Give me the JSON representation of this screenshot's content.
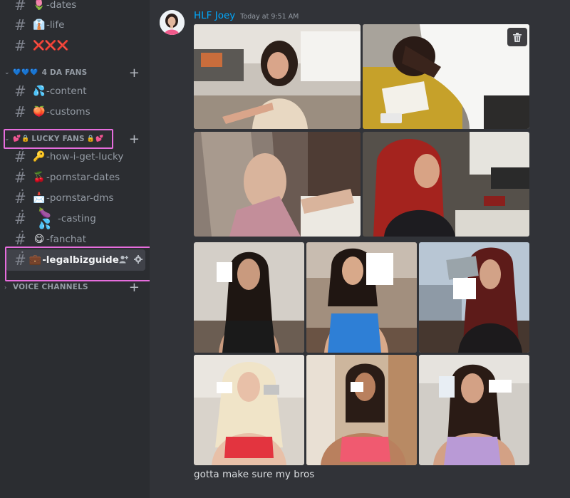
{
  "sidebar": {
    "channels_top": [
      {
        "emoji": "🌷",
        "label": "-dates"
      },
      {
        "emoji": "👔",
        "label": "-life"
      },
      {
        "emoji": "",
        "label": "❌❌❌"
      }
    ],
    "category_fans": {
      "emoji": "💙💙💙",
      "label": "4 DA FANS"
    },
    "channels_fans": [
      {
        "emoji": "💦",
        "label": "-content"
      },
      {
        "emoji": "🍑",
        "label": "-customs"
      }
    ],
    "category_lucky": {
      "emoji_left": "💕🔒",
      "label": "LUCKY FANS",
      "emoji_right": "🔒💕"
    },
    "channels_lucky": [
      {
        "emoji": "🔑",
        "label": "-how-i-get-lucky"
      },
      {
        "emoji": "🍒",
        "label": "-pornstar-dates"
      },
      {
        "emoji": "📩",
        "label": "-pornstar-dms"
      },
      {
        "emoji": "🍆💦",
        "label": "-casting"
      },
      {
        "emoji": "😋",
        "label": "-fanchat"
      },
      {
        "emoji": "💼",
        "label": "-legalbizguide"
      }
    ],
    "voice_category": "VOICE CHANNELS"
  },
  "message": {
    "author": "HLF Joey",
    "timestamp": "Today at 9:51 AM",
    "text": "gotta make sure my bros"
  },
  "colors": {
    "accent_author": "#00a8fc",
    "highlight_box": "#e66ddd",
    "sidebar_bg": "#2b2d31",
    "main_bg": "#313338"
  },
  "icons": {
    "channel": "hash-icon",
    "locked_channel": "hash-lock-icon",
    "add": "plus-icon",
    "invite": "add-member-icon",
    "settings": "gear-icon",
    "delete": "trash-icon"
  }
}
